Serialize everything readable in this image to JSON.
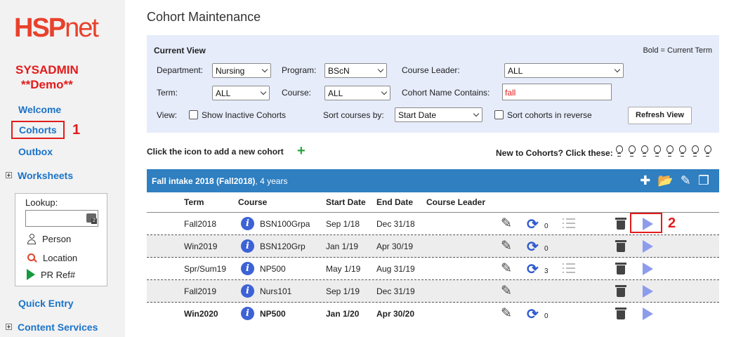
{
  "sidebar": {
    "logo": "HSPnet",
    "user_role": "SYSADMIN",
    "user_mode": "**Demo**",
    "links": {
      "welcome": "Welcome",
      "cohorts": "Cohorts",
      "outbox": "Outbox",
      "worksheets": "Worksheets",
      "quick_entry": "Quick Entry",
      "content_services": "Content Services"
    },
    "lookup": {
      "label": "Lookup:",
      "value": "",
      "person": "Person",
      "location": "Location",
      "pr_ref": "PR Ref#"
    }
  },
  "annotations": {
    "one": "1",
    "two": "2"
  },
  "page_title": "Cohort Maintenance",
  "view_panel": {
    "title": "Current View",
    "note": "Bold = Current Term",
    "department_label": "Department:",
    "department_value": "Nursing",
    "program_label": "Program:",
    "program_value": "BScN",
    "course_leader_label": "Course Leader:",
    "course_leader_value": "ALL",
    "term_label": "Term:",
    "term_value": "ALL",
    "course_label": "Course:",
    "course_value": "ALL",
    "name_contains_label": "Cohort Name Contains:",
    "name_contains_value": "fall",
    "view_label": "View:",
    "show_inactive_label": "Show Inactive Cohorts",
    "show_inactive_checked": false,
    "sort_label": "Sort courses by:",
    "sort_value": "Start Date",
    "sort_reverse_label": "Sort cohorts in reverse",
    "sort_reverse_checked": false,
    "refresh_label": "Refresh View"
  },
  "add_cohort_text": "Click the icon to add a new cohort",
  "new_to_cohorts_text": "New to Cohorts? Click these:",
  "cohort": {
    "name": "Fall intake 2018 (Fall2018)",
    "duration": ", 4 years",
    "columns": {
      "term": "Term",
      "course": "Course",
      "start": "Start Date",
      "end": "End Date",
      "leader": "Course Leader"
    },
    "rows": [
      {
        "term": "Fall2018",
        "course": "BSN100Grpa",
        "start": "Sep 1/18",
        "end": "Dec 31/18",
        "sync_count": "0",
        "current": false
      },
      {
        "term": "Win2019",
        "course": "BSN120Grp",
        "start": "Jan 1/19",
        "end": "Apr 30/19",
        "sync_count": "0",
        "current": false
      },
      {
        "term": "Spr/Sum19",
        "course": "NP500",
        "start": "May 1/19",
        "end": "Aug 31/19",
        "sync_count": "3",
        "current": false
      },
      {
        "term": "Fall2019",
        "course": "Nurs101",
        "start": "Sep 1/19",
        "end": "Dec 31/19",
        "sync_count": "",
        "current": false
      },
      {
        "term": "Win2020",
        "course": "NP500",
        "start": "Jan 1/20",
        "end": "Apr 30/20",
        "sync_count": "0",
        "current": true
      }
    ]
  },
  "colors": {
    "brand_red": "#e8412c",
    "link_blue": "#1a73c8",
    "header_blue": "#2f7fc1",
    "panel_bg": "#e6ecfa",
    "annotation_red": "#e31b1b"
  }
}
